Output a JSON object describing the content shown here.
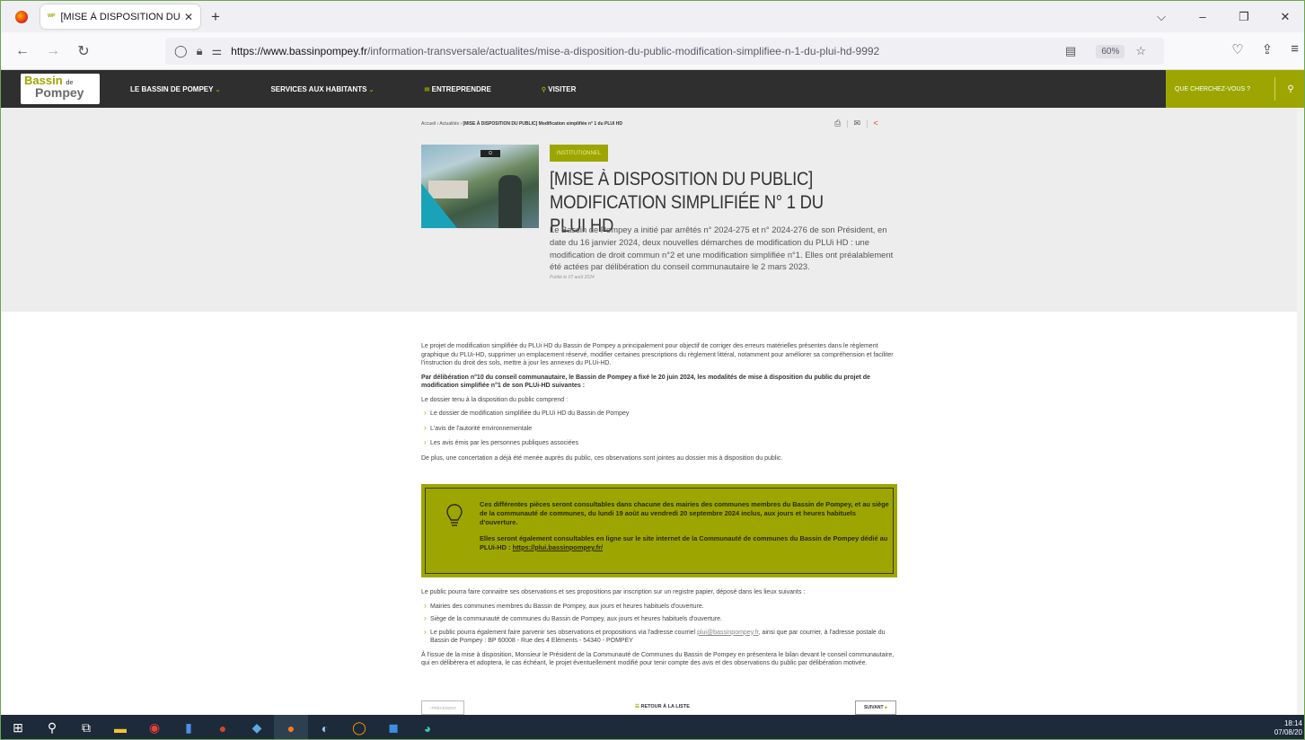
{
  "browser": {
    "tab_title": "[MISE À DISPOSITION DU PUBLI",
    "tab_favicon": "ᵂᴾ",
    "url_host": "https://www.bassinpompey.fr",
    "url_path": "/information-transversale/actualites/mise-a-disposition-du-public-modification-simplifiee-n-1-du-plui-hd-9992",
    "zoom": "60%",
    "accent": "#6aa84f"
  },
  "site": {
    "logo_line1": "Bassin",
    "logo_de": "de",
    "logo_line2": "Pompey",
    "brand_color": "#9da600",
    "menu": [
      {
        "label": "LE BASSIN DE POMPEY",
        "arrow": "⌄"
      },
      {
        "label": "SERVICES AUX HABITANTS",
        "arrow": "⌄"
      },
      {
        "label": "ENTREPRENDRE",
        "prefix": "✉"
      },
      {
        "label": "VISITER",
        "prefix": "⚲"
      }
    ],
    "search_placeholder": "QUE CHERCHEZ-VOUS ?"
  },
  "article": {
    "breadcrumb_home": "Accueil",
    "breadcrumb_sep": "›",
    "breadcrumb_news": "Actualités",
    "breadcrumb_current": "[MISE À DISPOSITION DU PUBLIC] Modification simplifiée n° 1 du PLUi HD",
    "image_sign": "Ω",
    "tag": "INSTITUTIONNEL",
    "title": "[MISE À DISPOSITION DU PUBLIC] MODIFICATION SIMPLIFIÉE N° 1 DU PLUI HD",
    "intro": "Le Bassin de Pompey a initié par arrêtés n° 2024-275 et n° 2024-276 de son Président, en date du 16 janvier 2024, deux nouvelles démarches de modification du PLUi HD : une modification de droit commun n°2 et une modification simplifiée n°1. Elles ont préalablement été actées par délibération du conseil communautaire le 2 mars 2023.",
    "published": "Publié le 07 août 2024",
    "p1": "Le projet de modification simplifiée du PLUi HD du Bassin de Pompey a principalement pour objectif de corriger des erreurs matérielles présentes dans le règlement graphique du PLUi-HD, supprimer un emplacement réservé, modifier certaines prescriptions du règlement littéral, notamment pour améliorer sa compréhension et faciliter l'instruction du droit des sols, mettre à jour les annexes du PLUi-HD.",
    "p2": "Par délibération n°10 du conseil communautaire, le Bassin de Pompey a fixé le 20 juin 2024, les modalités de mise à disposition du public du projet de modification simplifiée n°1 de son PLUi-HD suivantes :",
    "p3": "Le dossier tenu à la disposition du public comprend :",
    "list1": [
      "Le dossier de modification simplifiée du PLUi HD du Bassin de Pompey",
      "L'avis de l'autorité environnementale",
      "Les avis émis par les personnes publiques associées"
    ],
    "p4": "De plus, une concertation a déjà été menée auprès du public, ces observations sont jointes au dossier mis à disposition du public.",
    "callout_p1": "Ces différentes pièces seront consultables dans chacune des mairies des communes membres du Bassin de Pompey, et au siège de la communauté de communes, du lundi 19 août au vendredi 20 septembre 2024 inclus, aux jours et heures habituels d'ouverture.",
    "callout_p2": "Elles seront également consultables en ligne sur le site internet de la Communauté de communes du Bassin de Pompey dédié au PLUi-HD :",
    "callout_link": "https://plui.bassinpompey.fr/",
    "p5": "Le public pourra faire connaitre ses observations et ses propositions par inscription sur un registre papier, déposé dans les lieux suivants :",
    "list2": [
      "Mairies des communes membres du Bassin de Pompey, aux jours et heures habituels d'ouverture.",
      "Siège de la communauté de communes du Bassin de Pompey, aux jours et heures habituels d'ouverture."
    ],
    "list2_3a": "Le public pourra également faire parvenir ses observations et propositions via l'adresse courriel",
    "list2_3_email": "plui@bassinpompey.fr",
    "list2_3b": ", ainsi que par courrier, à l'adresse postale du Bassin de Pompey : BP 60008 - Rue des 4 Eléments - 54340 - POMPEY",
    "p6": "À l'issue de la mise à disposition, Monsieur le Président de la Communauté de Communes du Bassin de Pompey en présentera le bilan devant le conseil communautaire, qui en délibèrera et adoptera, le cas échéant, le projet éventuellement modifié pour tenir compte des avis et des observations du public par délibération motivée.",
    "prev_label": "‹ PRÉCÉDENT",
    "back_label": "RETOUR À LA LISTE",
    "next_label": "SUIVANT"
  },
  "taskbar": {
    "time": "18:14",
    "date": "07/08/20"
  }
}
